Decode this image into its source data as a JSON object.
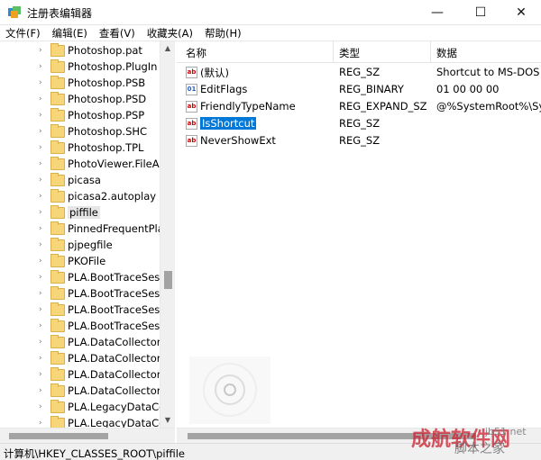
{
  "window": {
    "title": "注册表编辑器",
    "icons": {
      "app": "registry-icon",
      "minimize": "minimize-icon",
      "maximize": "maximize-icon",
      "close": "close-icon"
    }
  },
  "menu": [
    "文件(F)",
    "编辑(E)",
    "查看(V)",
    "收藏夹(A)",
    "帮助(H)"
  ],
  "tree": {
    "items": [
      {
        "label": "Photoshop.pat"
      },
      {
        "label": "Photoshop.PlugIn"
      },
      {
        "label": "Photoshop.PSB"
      },
      {
        "label": "Photoshop.PSD"
      },
      {
        "label": "Photoshop.PSP"
      },
      {
        "label": "Photoshop.SHC"
      },
      {
        "label": "Photoshop.TPL"
      },
      {
        "label": "PhotoViewer.FileAss"
      },
      {
        "label": "picasa"
      },
      {
        "label": "picasa2.autoplay"
      },
      {
        "label": "piffile",
        "selected": true
      },
      {
        "label": "PinnedFrequentPlac"
      },
      {
        "label": "pjpegfile"
      },
      {
        "label": "PKOFile"
      },
      {
        "label": "PLA.BootTraceSessi"
      },
      {
        "label": "PLA.BootTraceSessi"
      },
      {
        "label": "PLA.BootTraceSessi"
      },
      {
        "label": "PLA.BootTraceSessi"
      },
      {
        "label": "PLA.DataCollectorSe"
      },
      {
        "label": "PLA.DataCollectorSe"
      },
      {
        "label": "PLA.DataCollectorSe"
      },
      {
        "label": "PLA.DataCollectorSe"
      },
      {
        "label": "PLA.LegacyDataColl"
      },
      {
        "label": "PLA.LegacyDataColl"
      }
    ]
  },
  "columns": {
    "name": "名称",
    "type": "类型",
    "data": "数据"
  },
  "values": [
    {
      "name": "(默认)",
      "type": "REG_SZ",
      "data": "Shortcut to MS-DOS P",
      "icon": "string-value-icon"
    },
    {
      "name": "EditFlags",
      "type": "REG_BINARY",
      "data": "01 00 00 00",
      "icon": "binary-value-icon"
    },
    {
      "name": "FriendlyTypeName",
      "type": "REG_EXPAND_SZ",
      "data": "@%SystemRoot%\\Sys",
      "icon": "string-value-icon"
    },
    {
      "name": "IsShortcut",
      "type": "REG_SZ",
      "data": "",
      "icon": "string-value-icon",
      "selected": true
    },
    {
      "name": "NeverShowExt",
      "type": "REG_SZ",
      "data": "",
      "icon": "string-value-icon"
    }
  ],
  "statusbar": {
    "path": "计算机\\HKEY_CLASSES_ROOT\\piffile"
  },
  "watermark": {
    "text": "成航软件网",
    "text2": "脚本之家",
    "site": "jb51.net"
  }
}
